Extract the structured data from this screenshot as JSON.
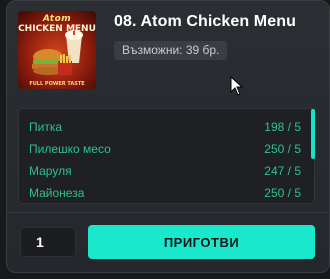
{
  "recipe": {
    "title": "08. Atom Chicken Menu",
    "available": "Възможни: 39 бр.",
    "image": {
      "brand": "Atom",
      "line1": "CHICKEN MENU",
      "tagline": "FULL POWER TASTE"
    }
  },
  "ingredients": [
    {
      "name": "Питка",
      "qty": "198 / 5"
    },
    {
      "name": "Пилешко месо",
      "qty": "250 / 5"
    },
    {
      "name": "Маруля",
      "qty": "247 / 5"
    },
    {
      "name": "Майонеза",
      "qty": "250 / 5"
    }
  ],
  "craft": {
    "quantity": "1",
    "button_label": "ПРИГОТВИ"
  },
  "colors": {
    "accent": "#19e8cc",
    "ingredient_text": "#2ec28a",
    "panel": "#2b2e33"
  }
}
